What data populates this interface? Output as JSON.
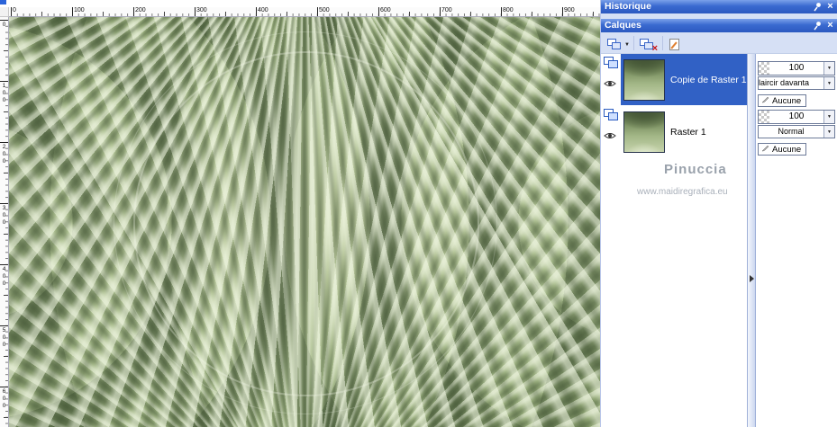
{
  "rulers": {
    "horizontal_labels": [
      "0",
      "100",
      "200",
      "300",
      "400",
      "500",
      "600",
      "700",
      "800",
      "900"
    ],
    "vertical_labels": [
      "0",
      "100",
      "200",
      "300",
      "400",
      "500",
      "600"
    ]
  },
  "panels": {
    "historique": {
      "title": "Historique"
    },
    "calques": {
      "title": "Calques",
      "layers": [
        {
          "name": "Copie de Raster 1",
          "opacity": "100",
          "blend_mode": "laircir davanta",
          "link": "Aucune"
        },
        {
          "name": "Raster 1",
          "opacity": "100",
          "blend_mode": "Normal",
          "link": "Aucune"
        }
      ]
    }
  },
  "watermark": {
    "name": "Pinuccia",
    "site": "www.maidiregrafica.eu"
  },
  "icons": {
    "dropdown_arrow": "▼",
    "close": "×",
    "delete_x": "×"
  },
  "colors": {
    "titlebar_blue": "#2c59c0",
    "panel_bg": "#d6e0f5",
    "selection_blue": "#3161c5",
    "canvas_green": "#9cb181"
  }
}
